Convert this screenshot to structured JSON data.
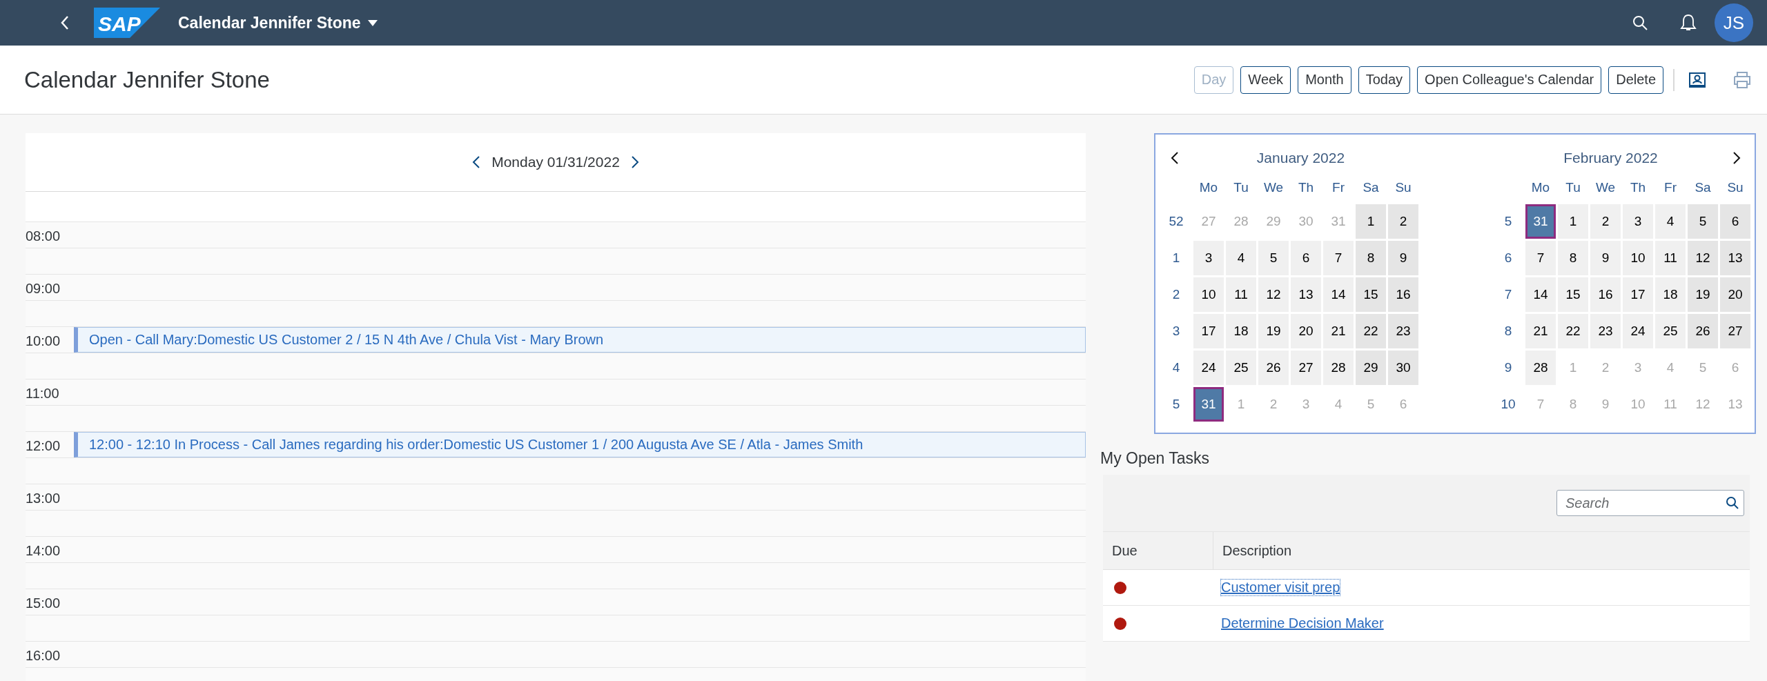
{
  "shell": {
    "logo_text": "SAP",
    "title": "Calendar Jennifer Stone",
    "avatar_initials": "JS"
  },
  "page": {
    "title": "Calendar Jennifer Stone",
    "buttons": [
      {
        "label": "Day",
        "disabled": true
      },
      {
        "label": "Week",
        "disabled": false
      },
      {
        "label": "Month",
        "disabled": false
      },
      {
        "label": "Today",
        "disabled": false
      },
      {
        "label": "Open Colleague's Calendar",
        "disabled": false
      },
      {
        "label": "Delete",
        "disabled": false
      }
    ]
  },
  "day_view": {
    "date_label": "Monday 01/31/2022",
    "slots": [
      {
        "label": "08:00"
      },
      {
        "label": "09:00"
      },
      {
        "label": "10:00",
        "events": [
          {
            "text": "Open - Call Mary:Domestic US Customer 2 / 15 N 4th Ave / Chula Vist - Mary Brown"
          }
        ]
      },
      {
        "label": "11:00"
      },
      {
        "label": "12:00",
        "events": [
          {
            "text": "12:00 - 12:10 In Process - Call James regarding his order:Domestic US Customer 1 / 200 Augusta Ave SE / Atla - James Smith"
          }
        ]
      },
      {
        "label": "13:00"
      },
      {
        "label": "14:00"
      },
      {
        "label": "15:00"
      },
      {
        "label": "16:00"
      }
    ]
  },
  "calendar": {
    "months": [
      {
        "title": "January 2022",
        "weekdays": [
          "Mo",
          "Tu",
          "We",
          "Th",
          "Fr",
          "Sa",
          "Su"
        ],
        "weeks": [
          {
            "week": "52",
            "days": [
              {
                "day": "27",
                "kind": "other",
                "selected": false
              },
              {
                "day": "28",
                "kind": "other",
                "selected": false
              },
              {
                "day": "29",
                "kind": "other",
                "selected": false
              },
              {
                "day": "30",
                "kind": "other",
                "selected": false
              },
              {
                "day": "31",
                "kind": "other",
                "selected": false
              },
              {
                "day": "1",
                "kind": "weekend",
                "selected": false
              },
              {
                "day": "2",
                "kind": "weekend",
                "selected": false
              }
            ]
          },
          {
            "week": "1",
            "days": [
              {
                "day": "3",
                "kind": "weekday",
                "selected": false
              },
              {
                "day": "4",
                "kind": "weekday",
                "selected": false
              },
              {
                "day": "5",
                "kind": "weekday",
                "selected": false
              },
              {
                "day": "6",
                "kind": "weekday",
                "selected": false
              },
              {
                "day": "7",
                "kind": "weekday",
                "selected": false
              },
              {
                "day": "8",
                "kind": "weekend",
                "selected": false
              },
              {
                "day": "9",
                "kind": "weekend",
                "selected": false
              }
            ]
          },
          {
            "week": "2",
            "days": [
              {
                "day": "10",
                "kind": "weekday",
                "selected": false
              },
              {
                "day": "11",
                "kind": "weekday",
                "selected": false
              },
              {
                "day": "12",
                "kind": "weekday",
                "selected": false
              },
              {
                "day": "13",
                "kind": "weekday",
                "selected": false
              },
              {
                "day": "14",
                "kind": "weekday",
                "selected": false
              },
              {
                "day": "15",
                "kind": "weekend",
                "selected": false
              },
              {
                "day": "16",
                "kind": "weekend",
                "selected": false
              }
            ]
          },
          {
            "week": "3",
            "days": [
              {
                "day": "17",
                "kind": "weekday",
                "selected": false
              },
              {
                "day": "18",
                "kind": "weekday",
                "selected": false
              },
              {
                "day": "19",
                "kind": "weekday",
                "selected": false
              },
              {
                "day": "20",
                "kind": "weekday",
                "selected": false
              },
              {
                "day": "21",
                "kind": "weekday",
                "selected": false
              },
              {
                "day": "22",
                "kind": "weekend",
                "selected": false
              },
              {
                "day": "23",
                "kind": "weekend",
                "selected": false
              }
            ]
          },
          {
            "week": "4",
            "days": [
              {
                "day": "24",
                "kind": "weekday",
                "selected": false
              },
              {
                "day": "25",
                "kind": "weekday",
                "selected": false
              },
              {
                "day": "26",
                "kind": "weekday",
                "selected": false
              },
              {
                "day": "27",
                "kind": "weekday",
                "selected": false
              },
              {
                "day": "28",
                "kind": "weekday",
                "selected": false
              },
              {
                "day": "29",
                "kind": "weekend",
                "selected": false
              },
              {
                "day": "30",
                "kind": "weekend",
                "selected": false
              }
            ]
          },
          {
            "week": "5",
            "days": [
              {
                "day": "31",
                "kind": "weekday",
                "selected": true
              },
              {
                "day": "1",
                "kind": "other",
                "selected": false
              },
              {
                "day": "2",
                "kind": "other",
                "selected": false
              },
              {
                "day": "3",
                "kind": "other",
                "selected": false
              },
              {
                "day": "4",
                "kind": "other",
                "selected": false
              },
              {
                "day": "5",
                "kind": "other",
                "selected": false
              },
              {
                "day": "6",
                "kind": "other",
                "selected": false
              }
            ]
          }
        ]
      },
      {
        "title": "February 2022",
        "weekdays": [
          "Mo",
          "Tu",
          "We",
          "Th",
          "Fr",
          "Sa",
          "Su"
        ],
        "weeks": [
          {
            "week": "5",
            "days": [
              {
                "day": "31",
                "kind": "weekday",
                "selected": true
              },
              {
                "day": "1",
                "kind": "weekday",
                "selected": false
              },
              {
                "day": "2",
                "kind": "weekday",
                "selected": false
              },
              {
                "day": "3",
                "kind": "weekday",
                "selected": false
              },
              {
                "day": "4",
                "kind": "weekday",
                "selected": false
              },
              {
                "day": "5",
                "kind": "weekend",
                "selected": false
              },
              {
                "day": "6",
                "kind": "weekend",
                "selected": false
              }
            ]
          },
          {
            "week": "6",
            "days": [
              {
                "day": "7",
                "kind": "weekday",
                "selected": false
              },
              {
                "day": "8",
                "kind": "weekday",
                "selected": false
              },
              {
                "day": "9",
                "kind": "weekday",
                "selected": false
              },
              {
                "day": "10",
                "kind": "weekday",
                "selected": false
              },
              {
                "day": "11",
                "kind": "weekday",
                "selected": false
              },
              {
                "day": "12",
                "kind": "weekend",
                "selected": false
              },
              {
                "day": "13",
                "kind": "weekend",
                "selected": false
              }
            ]
          },
          {
            "week": "7",
            "days": [
              {
                "day": "14",
                "kind": "weekday",
                "selected": false
              },
              {
                "day": "15",
                "kind": "weekday",
                "selected": false
              },
              {
                "day": "16",
                "kind": "weekday",
                "selected": false
              },
              {
                "day": "17",
                "kind": "weekday",
                "selected": false
              },
              {
                "day": "18",
                "kind": "weekday",
                "selected": false
              },
              {
                "day": "19",
                "kind": "weekend",
                "selected": false
              },
              {
                "day": "20",
                "kind": "weekend",
                "selected": false
              }
            ]
          },
          {
            "week": "8",
            "days": [
              {
                "day": "21",
                "kind": "weekday",
                "selected": false
              },
              {
                "day": "22",
                "kind": "weekday",
                "selected": false
              },
              {
                "day": "23",
                "kind": "weekday",
                "selected": false
              },
              {
                "day": "24",
                "kind": "weekday",
                "selected": false
              },
              {
                "day": "25",
                "kind": "weekday",
                "selected": false
              },
              {
                "day": "26",
                "kind": "weekend",
                "selected": false
              },
              {
                "day": "27",
                "kind": "weekend",
                "selected": false
              }
            ]
          },
          {
            "week": "9",
            "days": [
              {
                "day": "28",
                "kind": "weekday",
                "selected": false
              },
              {
                "day": "1",
                "kind": "other",
                "selected": false
              },
              {
                "day": "2",
                "kind": "other",
                "selected": false
              },
              {
                "day": "3",
                "kind": "other",
                "selected": false
              },
              {
                "day": "4",
                "kind": "other",
                "selected": false
              },
              {
                "day": "5",
                "kind": "other",
                "selected": false
              },
              {
                "day": "6",
                "kind": "other",
                "selected": false
              }
            ]
          },
          {
            "week": "10",
            "days": [
              {
                "day": "7",
                "kind": "other",
                "selected": false
              },
              {
                "day": "8",
                "kind": "other",
                "selected": false
              },
              {
                "day": "9",
                "kind": "other",
                "selected": false
              },
              {
                "day": "10",
                "kind": "other",
                "selected": false
              },
              {
                "day": "11",
                "kind": "other",
                "selected": false
              },
              {
                "day": "12",
                "kind": "other",
                "selected": false
              },
              {
                "day": "13",
                "kind": "other",
                "selected": false
              }
            ]
          }
        ]
      }
    ]
  },
  "tasks": {
    "title": "My Open Tasks",
    "search": {
      "placeholder": "Search"
    },
    "columns": [
      "Due",
      "Description"
    ],
    "rows": [
      {
        "color": "#b0190f",
        "description": "Customer visit prep",
        "focused": true
      },
      {
        "color": "#b0190f",
        "description": "Determine Decision Maker",
        "focused": false
      }
    ]
  }
}
